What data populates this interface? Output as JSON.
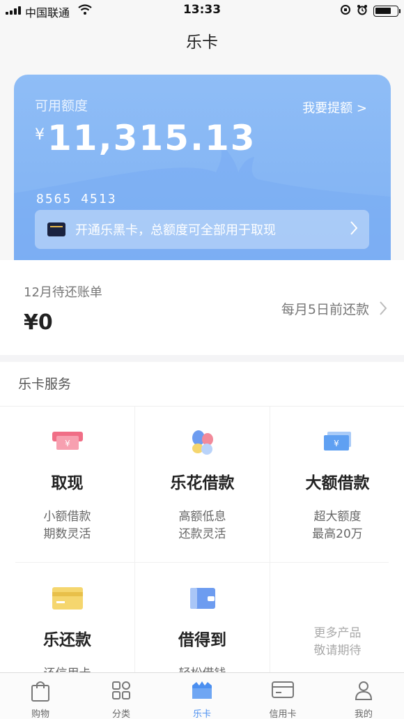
{
  "status": {
    "carrier": "中国联通",
    "time": "13:33"
  },
  "nav": {
    "title": "乐卡"
  },
  "card": {
    "available_label": "可用额度",
    "raise_link": "我要提额 >",
    "currency": "¥",
    "amount": "11,315.13",
    "card_number": "8565 4513",
    "promo_text": "开通乐黑卡，总额度可全部用于取现"
  },
  "bill": {
    "label": "12月待还账单",
    "amount": "¥0",
    "due_text": "每月5日前还款"
  },
  "services": {
    "title": "乐卡服务",
    "items": [
      {
        "name": "取现",
        "line1": "小额借款",
        "line2": "期数灵活",
        "icon": "cash-icon",
        "color": "#f06e86"
      },
      {
        "name": "乐花借款",
        "line1": "高额低息",
        "line2": "还款灵活",
        "icon": "petal-icon",
        "color": "#5b8ff0"
      },
      {
        "name": "大额借款",
        "line1": "超大额度",
        "line2": "最高20万",
        "icon": "banknote-icon",
        "color": "#5fa0f2"
      },
      {
        "name": "乐还款",
        "line1": "还信用卡",
        "line2": "",
        "icon": "repay-card-icon",
        "color": "#f5d66e"
      },
      {
        "name": "借得到",
        "line1": "轻松借钱",
        "line2": "",
        "icon": "wallet-icon",
        "color": "#6d9cf0"
      }
    ],
    "more_line1": "更多产品",
    "more_line2": "敬请期待"
  },
  "tabs": [
    {
      "label": "购物",
      "icon": "shopping-bag-icon"
    },
    {
      "label": "分类",
      "icon": "category-grid-icon"
    },
    {
      "label": "乐卡",
      "icon": "lecard-icon",
      "active": true
    },
    {
      "label": "信用卡",
      "icon": "credit-card-icon"
    },
    {
      "label": "我的",
      "icon": "profile-icon"
    }
  ],
  "colors": {
    "accent": "#4b8ff0",
    "card_blue": "#8fbdf6"
  }
}
